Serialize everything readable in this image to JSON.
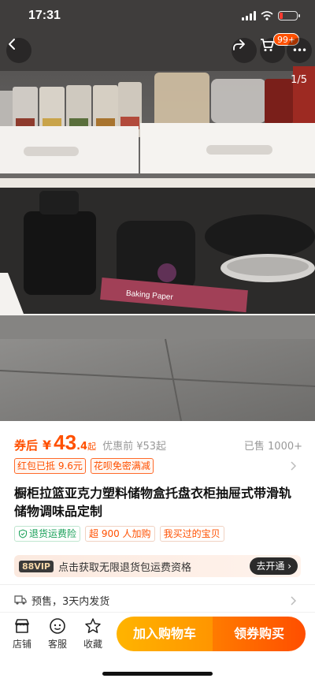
{
  "status_bar": {
    "time": "17:31"
  },
  "hero": {
    "page_indicator": "1/5",
    "cart_badge": "99+",
    "more_label": "•••",
    "overlay_colors": {
      "badge": "#ff5000",
      "button_bg": "rgba(0,0,0,0.35)"
    },
    "product_print_text": "Baking Paper"
  },
  "price": {
    "coupon_label": "券后",
    "currency": "¥",
    "integer": "43",
    "decimal": ".4",
    "suffix": "起",
    "original": "优惠前 ¥53起",
    "sold": "已售 1000+"
  },
  "tags": [
    "红包已抵 9.6元",
    "花呗免密满减"
  ],
  "title": "橱柜拉篮亚克力塑料储物盒托盘衣柜抽屉式带滑轨储物调味品定制",
  "services": [
    {
      "label": "退货运费险",
      "style": "green",
      "icon": "shield-check-icon"
    },
    {
      "label": "超 900 人加购",
      "style": "orange"
    },
    {
      "label": "我买过的宝贝",
      "style": "orange"
    }
  ],
  "vip": {
    "badge": "88VIP",
    "text": "点击获取无限退货包运费资格",
    "action": "去开通"
  },
  "shipping": {
    "text": "预售，3天内发货"
  },
  "bottom_bar": {
    "shop_label": "店铺",
    "service_label": "客服",
    "favorite_label": "收藏",
    "add_cart_label": "加入购物车",
    "buy_label": "领券购买"
  },
  "colors": {
    "accent": "#ff5000",
    "cart_button": "#ffa800",
    "buy_button": "#ff5a00",
    "green": "#18a058"
  }
}
